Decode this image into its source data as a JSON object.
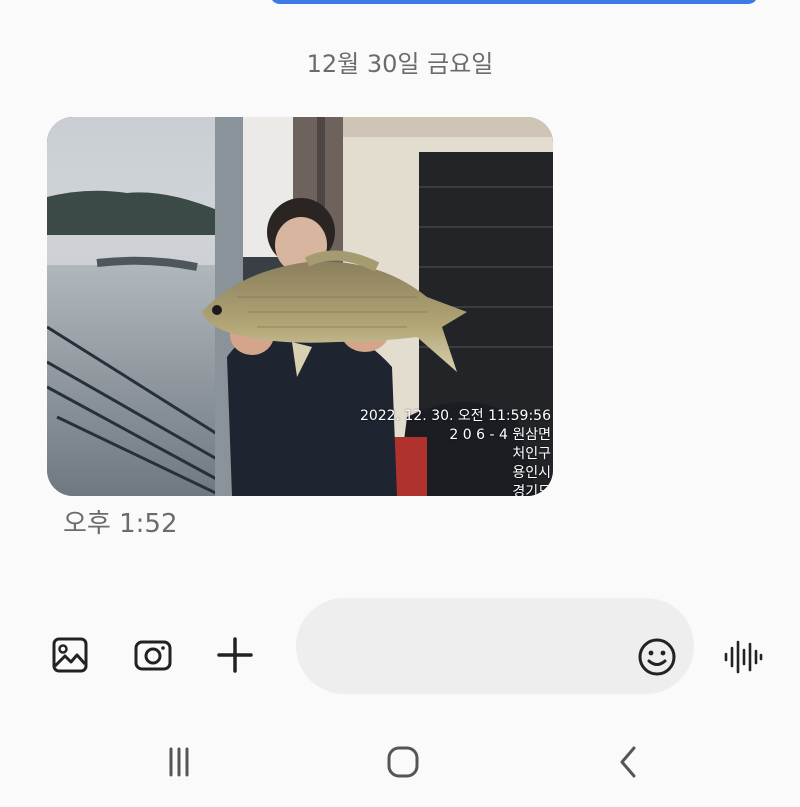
{
  "conversation": {
    "date_separator": "12월 30일 금요일",
    "messages": [
      {
        "type": "image",
        "image_caption_stamp": [
          "2022. 12. 30. 오전 11:59:56",
          "2 0 6 - 4 원삼면",
          "처인구",
          "용인시",
          "경기도"
        ],
        "time": "오후 1:52"
      }
    ]
  },
  "composer": {
    "placeholder": "",
    "icons": [
      "gallery-icon",
      "camera-icon",
      "plus-icon",
      "emoji-icon",
      "voice-record-icon"
    ]
  },
  "navigation": {
    "icons": [
      "recent-apps-icon",
      "home-icon",
      "back-icon"
    ]
  },
  "colors": {
    "background": "#fafafa",
    "accent": "#3d7ae6",
    "input_bg": "#eeeeee",
    "secondary_text": "#6b6b6b"
  }
}
